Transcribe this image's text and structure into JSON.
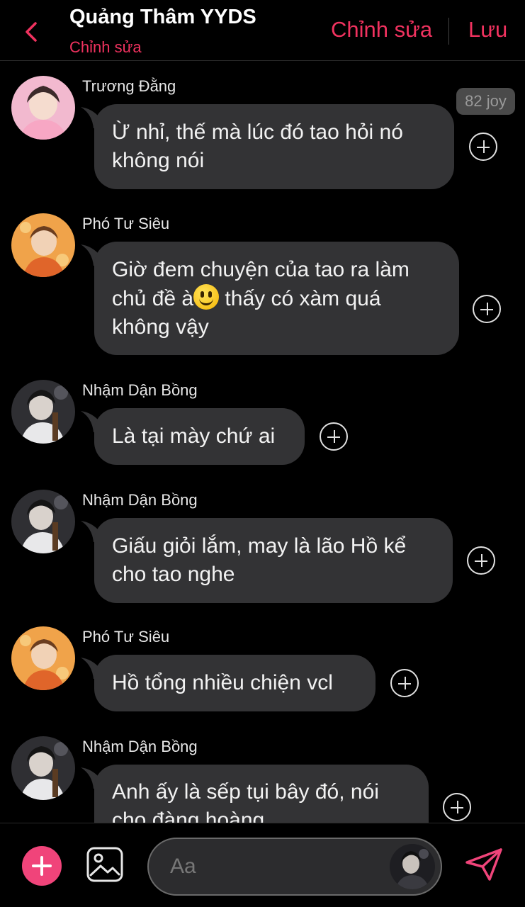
{
  "header": {
    "back_icon": "chevron-left-icon",
    "title": "Quảng Thâm YYDS",
    "subtitle": "Chỉnh sửa",
    "edit_label": "Chỉnh sửa",
    "save_label": "Lưu",
    "accent_color": "#f0325f"
  },
  "messages": [
    {
      "sender": "Trương Đằng",
      "text": "Ừ nhỉ, thế mà lúc đó tao hỏi nó không nói",
      "badge": "82 joy"
    },
    {
      "sender": "Phó Tư Siêu",
      "text_before_emoji": "Giờ đem chuyện của tao ra làm chủ đề à",
      "emoji": "smiley-emoji",
      "text_after_emoji": " thấy có xàm quá không vậy"
    },
    {
      "sender": "Nhậm Dận Bồng",
      "text": "Là tại mày chứ ai"
    },
    {
      "sender": "Nhậm Dận Bồng",
      "text": "Giấu giỏi lắm, may là lão Hồ kể cho tao nghe"
    },
    {
      "sender": "Phó Tư Siêu",
      "text": "Hồ tổng nhiều chiện vcl"
    },
    {
      "sender": "Nhậm Dận Bồng",
      "text": "Anh ấy là sếp tụi bây đó, nói cho đàng hoàng"
    }
  ],
  "composer": {
    "add_icon": "plus-icon",
    "image_icon": "image-icon",
    "placeholder": "Aa",
    "send_icon": "send-icon",
    "add_color": "#f0447a"
  }
}
